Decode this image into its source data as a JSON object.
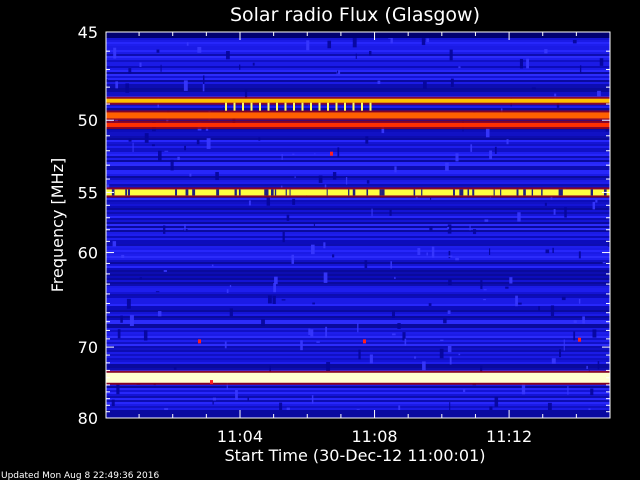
{
  "chart_data": {
    "type": "heatmap",
    "title": "Solar radio Flux (Glasgow)",
    "xlabel": "Start Time (30-Dec-12 11:00:01)",
    "ylabel": "Frequency [MHz]",
    "x_unit": "time",
    "x_range": [
      "11:00:01",
      "11:15:00"
    ],
    "x_ticks": [
      "11:04",
      "11:08",
      "11:12"
    ],
    "y_unit": "MHz",
    "y_range": [
      45,
      80
    ],
    "y_ticks": [
      45,
      50,
      55,
      60,
      70,
      80
    ],
    "y_scale": "nonlinear (1/frequency-like spacing)",
    "colormap": [
      "#000060",
      "#1010c8",
      "#2828ff",
      "#c80000",
      "#ff4000",
      "#ffc000",
      "#ffff80",
      "#ffffe0"
    ],
    "emission_bands": [
      {
        "frequency_mhz": 48.8,
        "intensity": "high",
        "color": "#ffc000"
      },
      {
        "frequency_mhz": 49.7,
        "intensity": "very high",
        "color": "#ff6000"
      },
      {
        "frequency_mhz": 50.3,
        "intensity": "high",
        "color": "#ff3000"
      },
      {
        "frequency_mhz": 55.0,
        "intensity": "very high",
        "color": "#ffff40"
      },
      {
        "frequency_mhz": 74.0,
        "intensity": "saturated",
        "color": "#ffffd0"
      }
    ]
  },
  "footer": {
    "updated": "Updated Mon Aug  8 22:49:36 2016"
  }
}
